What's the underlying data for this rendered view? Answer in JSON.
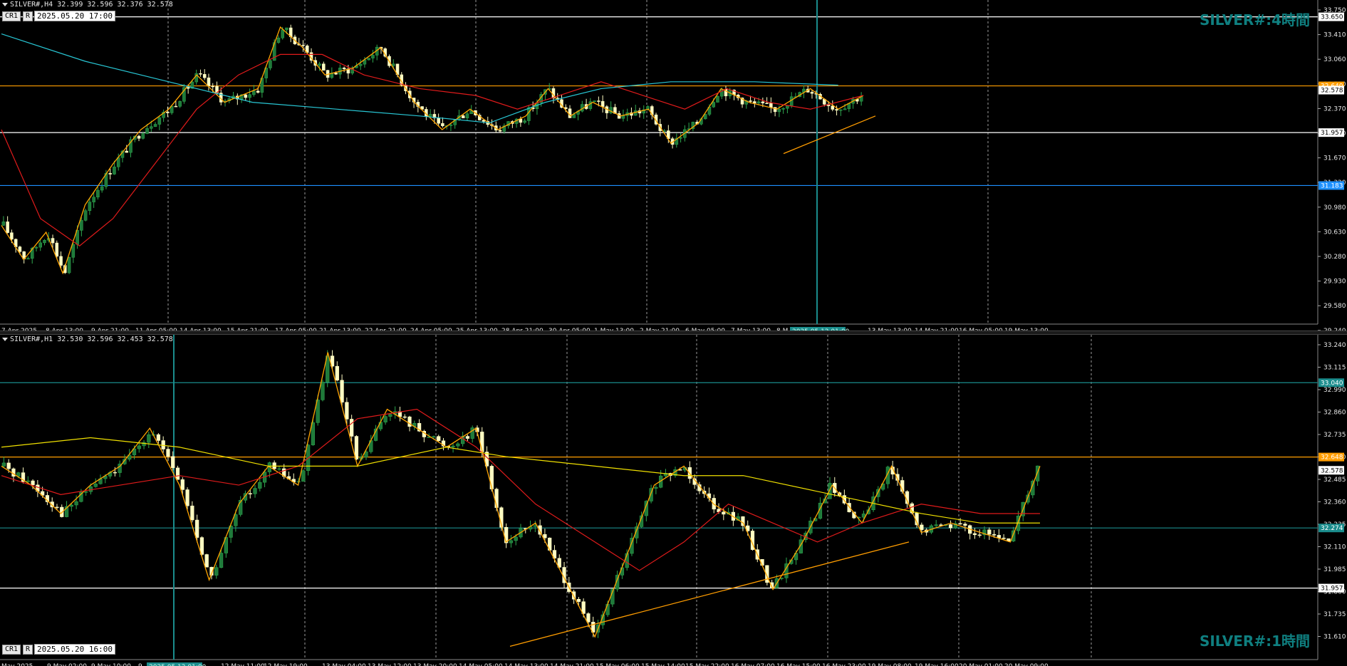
{
  "top": {
    "header": "SILVER#,H4  32.399 32.596 32.376 32.578",
    "cr_label": "CR1",
    "r_label": "R",
    "date_box": "2025.05.20 17:00",
    "watermark": "SILVER#:4時間",
    "yticks": [
      "33.750",
      "33.410",
      "33.060",
      "32.710",
      "32.370",
      "32.020",
      "31.670",
      "31.320",
      "30.980",
      "30.630",
      "30.280",
      "29.930",
      "29.580",
      "29.240"
    ],
    "ymin": 29.24,
    "ymax": 33.75,
    "xticks": [
      "7 Apr 2025",
      "8 Apr 13:00",
      "9 Apr 21:00",
      "11 Apr 05:00",
      "14 Apr 13:00",
      "15 Apr 21:00",
      "17 Apr 05:00",
      "21 Apr 13:00",
      "22 Apr 21:00",
      "24 Apr 05:00",
      "25 Apr 13:00",
      "28 Apr 21:00",
      "30 Apr 05:00",
      "1 May 13:00",
      "2 May 21:00",
      "6 May 05:00",
      "7 May 13:00",
      "8 M",
      "05:00",
      "13 May 13:00",
      "14 May 21:00",
      "16 May 05:00",
      "19 May 13:00"
    ],
    "crosshair_label": "2025.05.12 01:00",
    "hlines": [
      {
        "price": 33.65,
        "color": "#ffffff",
        "label": "33.650"
      },
      {
        "price": 32.64,
        "color": "#ff9d00",
        "label": "32.640"
      },
      {
        "price": 31.957,
        "color": "#ffffff",
        "label": "31.957"
      },
      {
        "price": 31.183,
        "color": "#1e90ff",
        "label": "31.183"
      }
    ],
    "bid_label": "32.578",
    "candle_count": 210,
    "path_points": [
      [
        0,
        30.6
      ],
      [
        8,
        30.1
      ],
      [
        16,
        30.5
      ],
      [
        22,
        29.9
      ],
      [
        30,
        30.9
      ],
      [
        40,
        31.5
      ],
      [
        50,
        32.0
      ],
      [
        60,
        32.3
      ],
      [
        70,
        32.8
      ],
      [
        80,
        32.4
      ],
      [
        92,
        32.6
      ],
      [
        100,
        33.5
      ],
      [
        108,
        33.2
      ],
      [
        116,
        32.8
      ],
      [
        126,
        32.9
      ],
      [
        136,
        33.2
      ],
      [
        148,
        32.4
      ],
      [
        158,
        32.0
      ],
      [
        168,
        32.3
      ],
      [
        178,
        32.0
      ],
      [
        188,
        32.2
      ],
      [
        196,
        32.6
      ],
      [
        204,
        32.2
      ],
      [
        212,
        32.4
      ],
      [
        222,
        32.2
      ],
      [
        232,
        32.3
      ],
      [
        240,
        31.8
      ],
      [
        250,
        32.1
      ],
      [
        258,
        32.6
      ],
      [
        268,
        32.4
      ],
      [
        278,
        32.3
      ],
      [
        290,
        32.6
      ],
      [
        300,
        32.3
      ],
      [
        309,
        32.5
      ]
    ],
    "ma_red": [
      [
        0,
        32.0
      ],
      [
        14,
        30.7
      ],
      [
        28,
        30.3
      ],
      [
        40,
        30.7
      ],
      [
        55,
        31.5
      ],
      [
        70,
        32.3
      ],
      [
        85,
        32.8
      ],
      [
        100,
        33.1
      ],
      [
        115,
        33.1
      ],
      [
        130,
        32.8
      ],
      [
        150,
        32.6
      ],
      [
        170,
        32.5
      ],
      [
        185,
        32.3
      ],
      [
        200,
        32.5
      ],
      [
        215,
        32.7
      ],
      [
        230,
        32.5
      ],
      [
        245,
        32.3
      ],
      [
        260,
        32.6
      ],
      [
        275,
        32.4
      ],
      [
        290,
        32.3
      ],
      [
        309,
        32.5
      ]
    ],
    "ma_cyan": [
      [
        0,
        33.4
      ],
      [
        30,
        33.0
      ],
      [
        60,
        32.7
      ],
      [
        90,
        32.4
      ],
      [
        120,
        32.3
      ],
      [
        150,
        32.2
      ],
      [
        175,
        32.1
      ],
      [
        195,
        32.4
      ],
      [
        215,
        32.6
      ],
      [
        240,
        32.7
      ],
      [
        270,
        32.7
      ],
      [
        300,
        32.65
      ]
    ],
    "trendline": [
      [
        1100,
        31.65
      ],
      [
        1229,
        32.2
      ]
    ]
  },
  "bottom": {
    "header": "SILVER#,H1  32.530 32.596 32.453 32.578",
    "cr_label": "CR1",
    "r_label": "R",
    "date_box": "2025.05.20 16:00",
    "watermark": "SILVER#:1時間",
    "yticks": [
      "33.240",
      "33.115",
      "32.990",
      "32.860",
      "32.735",
      "32.610",
      "32.485",
      "32.360",
      "32.235",
      "32.110",
      "31.985",
      "31.860",
      "31.735",
      "31.610"
    ],
    "ymin": 31.61,
    "ymax": 33.24,
    "xticks": [
      "May 2025",
      "9 May 02:00",
      "9 May 10:00",
      "9",
      "y 03:00",
      "12 May 11:00",
      "12 May 19:00",
      "13 May 04:00",
      "13 May 12:00",
      "13 May 20:00",
      "14 May 05:00",
      "14 May 13:00",
      "14 May 21:00",
      "15 May 06:00",
      "15 May 14:00",
      "15 May 22:00",
      "16 May 07:00",
      "16 May 15:00",
      "16 May 23:00",
      "19 May 08:00",
      "19 May 16:00",
      "20 May 01:00",
      "20 May 09:00"
    ],
    "crosshair_label": "2025.05.12 01:00",
    "hlines": [
      {
        "price": 33.04,
        "color": "#1a8c8c",
        "label": "33.040"
      },
      {
        "price": 32.648,
        "color": "#ff9d00",
        "label": "32.648"
      },
      {
        "price": 32.274,
        "color": "#1a8c8c",
        "label": "32.274"
      },
      {
        "price": 31.957,
        "color": "#ffffff",
        "label": "31.957"
      }
    ],
    "bid_label": "32.578",
    "candle_count": 215,
    "path_points": [
      [
        0,
        32.6
      ],
      [
        10,
        32.5
      ],
      [
        20,
        32.35
      ],
      [
        30,
        32.5
      ],
      [
        40,
        32.6
      ],
      [
        50,
        32.8
      ],
      [
        60,
        32.5
      ],
      [
        70,
        32.0
      ],
      [
        80,
        32.4
      ],
      [
        90,
        32.6
      ],
      [
        100,
        32.5
      ],
      [
        110,
        33.2
      ],
      [
        120,
        32.6
      ],
      [
        130,
        32.9
      ],
      [
        140,
        32.8
      ],
      [
        150,
        32.7
      ],
      [
        160,
        32.8
      ],
      [
        170,
        32.2
      ],
      [
        180,
        32.3
      ],
      [
        190,
        32.0
      ],
      [
        200,
        31.7
      ],
      [
        210,
        32.1
      ],
      [
        220,
        32.5
      ],
      [
        230,
        32.6
      ],
      [
        240,
        32.4
      ],
      [
        250,
        32.3
      ],
      [
        260,
        31.95
      ],
      [
        270,
        32.2
      ],
      [
        280,
        32.5
      ],
      [
        290,
        32.3
      ],
      [
        300,
        32.6
      ],
      [
        310,
        32.25
      ],
      [
        320,
        32.3
      ],
      [
        330,
        32.25
      ],
      [
        340,
        32.2
      ],
      [
        350,
        32.6
      ]
    ],
    "ma_red": [
      [
        0,
        32.55
      ],
      [
        20,
        32.45
      ],
      [
        40,
        32.5
      ],
      [
        60,
        32.55
      ],
      [
        80,
        32.5
      ],
      [
        100,
        32.6
      ],
      [
        120,
        32.85
      ],
      [
        140,
        32.9
      ],
      [
        160,
        32.7
      ],
      [
        180,
        32.4
      ],
      [
        200,
        32.2
      ],
      [
        215,
        32.05
      ],
      [
        230,
        32.2
      ],
      [
        245,
        32.4
      ],
      [
        260,
        32.3
      ],
      [
        275,
        32.2
      ],
      [
        290,
        32.3
      ],
      [
        310,
        32.4
      ],
      [
        330,
        32.35
      ],
      [
        350,
        32.35
      ]
    ],
    "ma_yellow": [
      [
        0,
        32.7
      ],
      [
        30,
        32.75
      ],
      [
        60,
        32.7
      ],
      [
        90,
        32.6
      ],
      [
        120,
        32.6
      ],
      [
        150,
        32.7
      ],
      [
        170,
        32.65
      ],
      [
        200,
        32.6
      ],
      [
        230,
        32.55
      ],
      [
        250,
        32.55
      ],
      [
        280,
        32.45
      ],
      [
        310,
        32.35
      ],
      [
        330,
        32.3
      ],
      [
        350,
        32.3
      ]
    ],
    "trendline": [
      [
        716,
        31.65
      ],
      [
        1276,
        32.2
      ]
    ]
  }
}
